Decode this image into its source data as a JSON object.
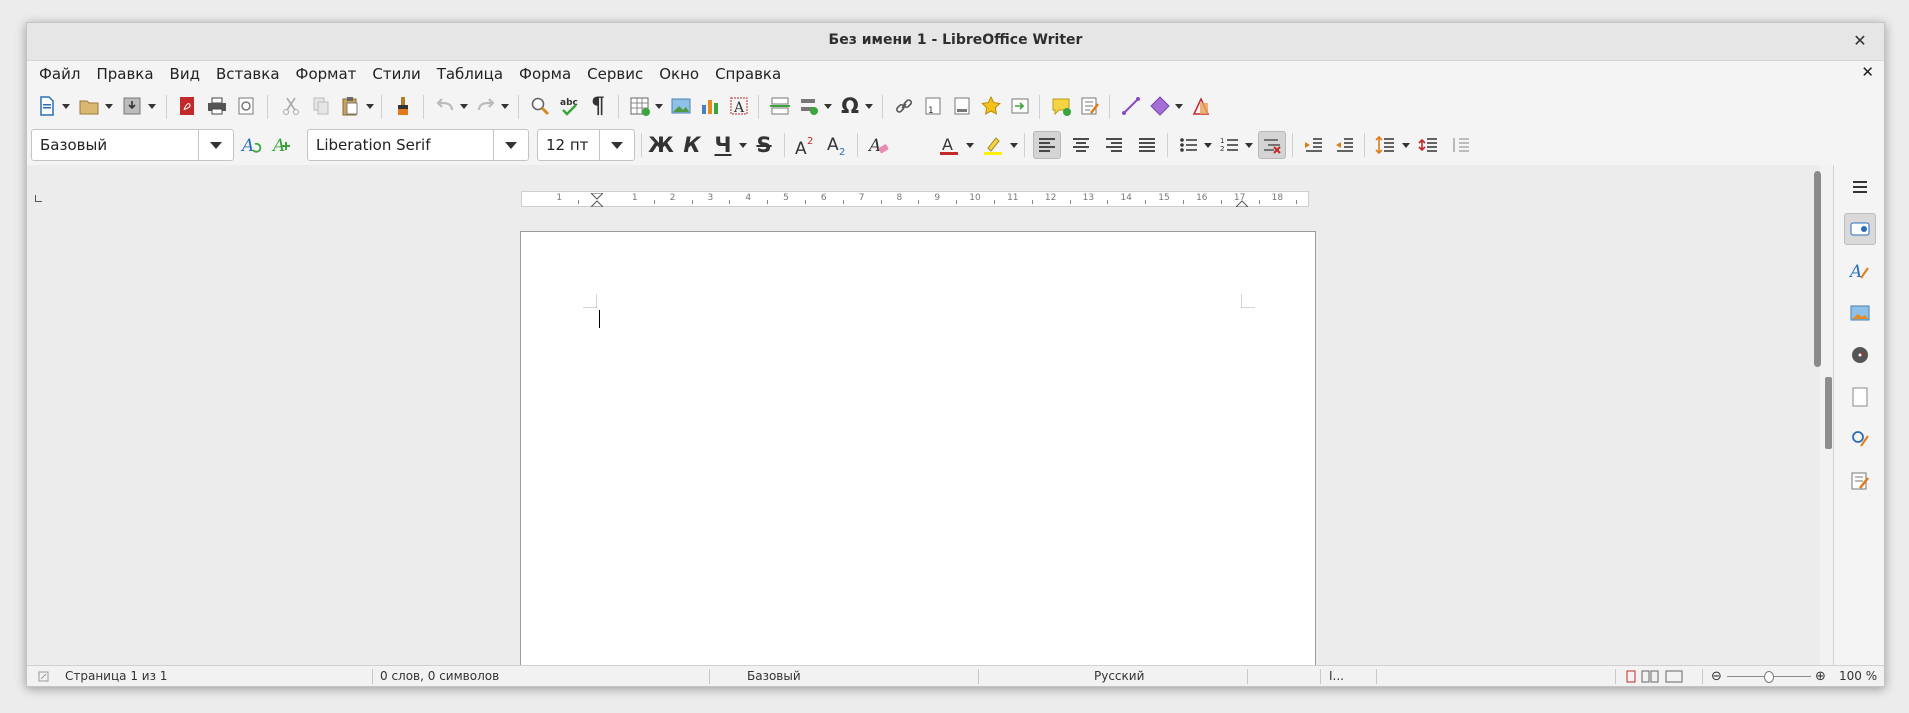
{
  "window": {
    "title": "Без имени 1 - LibreOffice Writer",
    "close_glyph": "✕"
  },
  "menubar": {
    "items": [
      "Файл",
      "Правка",
      "Вид",
      "Вставка",
      "Формат",
      "Стили",
      "Таблица",
      "Форма",
      "Сервис",
      "Окно",
      "Справка"
    ],
    "close_glyph": "✕"
  },
  "formatting": {
    "paragraph_style": "Базовый",
    "font_name": "Liberation Serif",
    "font_size": "12 пт",
    "bold_glyph": "Ж",
    "italic_glyph": "К",
    "underline_glyph": "Ч",
    "strike_glyph": "S",
    "accent_color": "#c4292a",
    "highlight_color": "#fff200"
  },
  "ruler": {
    "labels": [
      "1",
      "1",
      "2",
      "3",
      "4",
      "5",
      "6",
      "7",
      "8",
      "9",
      "10",
      "11",
      "12",
      "13",
      "14",
      "15",
      "16",
      "17",
      "18"
    ]
  },
  "statusbar": {
    "page": "Страница 1 из 1",
    "words": "0 слов, 0 символов",
    "style": "Базовый",
    "language": "Русский",
    "selection_mode": "I...",
    "zoom": "100 %"
  }
}
